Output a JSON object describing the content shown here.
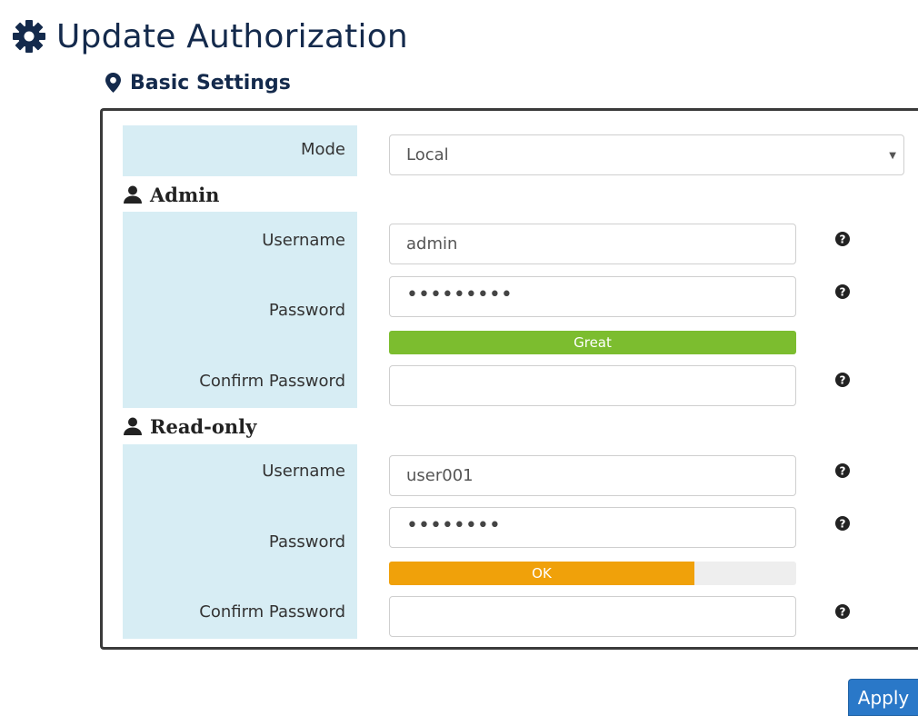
{
  "page": {
    "title": "Update Authorization"
  },
  "section": {
    "title": "Basic Settings"
  },
  "mode": {
    "label": "Mode",
    "value": "Local"
  },
  "admin": {
    "heading": "Admin",
    "username_label": "Username",
    "username_value": "admin",
    "password_label": "Password",
    "password_masked": "•••••••••",
    "strength_label": "Great",
    "strength_percent": 100,
    "strength_color": "#7cbd2f",
    "confirm_label": "Confirm Password",
    "confirm_value": ""
  },
  "readonly": {
    "heading": "Read-only",
    "username_label": "Username",
    "username_value": "user001",
    "password_label": "Password",
    "password_masked": "••••••••",
    "strength_label": "OK",
    "strength_percent": 75,
    "strength_color": "#f0a10a",
    "confirm_label": "Confirm Password",
    "confirm_value": ""
  },
  "actions": {
    "apply_label": "Apply"
  },
  "colors": {
    "heading": "#142a4c",
    "label_bg": "#d7edf4",
    "apply_bg": "#2a78c8"
  },
  "icons": {
    "title": "gear-icon",
    "section": "map-marker-icon",
    "group": "user-icon",
    "help": "question-circle-icon",
    "select": "caret-down-icon"
  }
}
